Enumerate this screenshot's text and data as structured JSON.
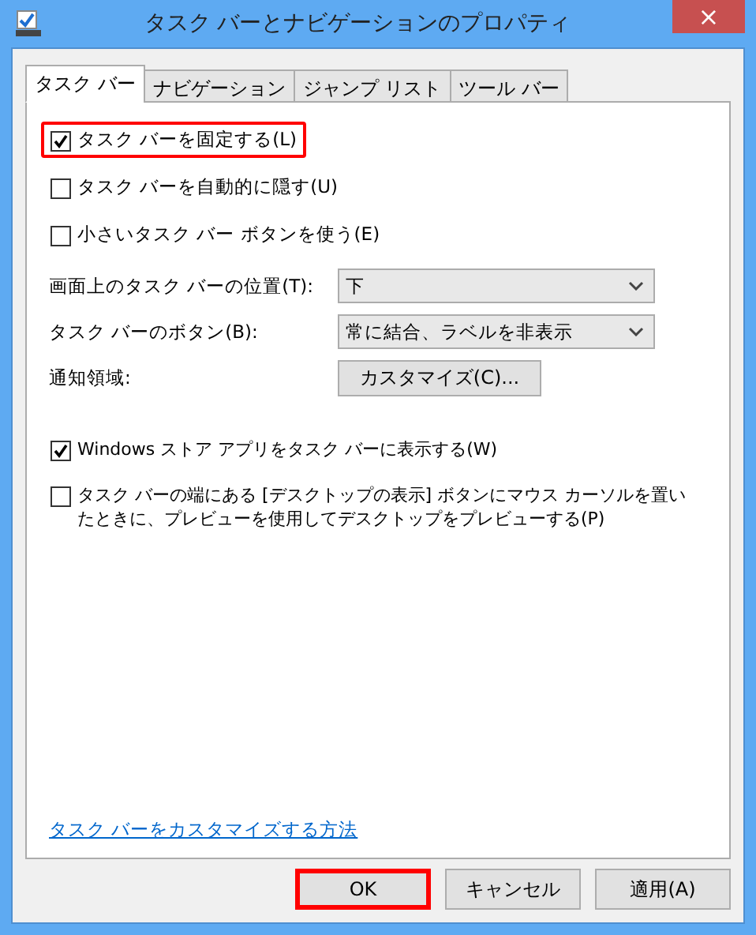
{
  "window": {
    "title": "タスク バーとナビゲーションのプロパティ",
    "close": "×"
  },
  "tabs": [
    {
      "label": "タスク バー",
      "selected": true
    },
    {
      "label": "ナビゲーション",
      "selected": false
    },
    {
      "label": "ジャンプ リスト",
      "selected": false
    },
    {
      "label": "ツール バー",
      "selected": false
    }
  ],
  "options_top": [
    {
      "label": "タスク バーを固定する(L)",
      "checked": true,
      "highlighted": true
    },
    {
      "label": "タスク バーを自動的に隠す(U)",
      "checked": false,
      "highlighted": false
    },
    {
      "label": "小さいタスク バー ボタンを使う(E)",
      "checked": false,
      "highlighted": false
    }
  ],
  "settings": [
    {
      "kind": "dropdown",
      "label": "画面上のタスク バーの位置(T):",
      "value": "下"
    },
    {
      "kind": "dropdown",
      "label": "タスク バーのボタン(B):",
      "value": "常に結合、ラベルを非表示"
    },
    {
      "kind": "button",
      "label": "通知領域:",
      "value": "カスタマイズ(C)..."
    }
  ],
  "options_bottom": [
    {
      "label": "Windows ストア アプリをタスク バーに表示する(W)",
      "checked": true,
      "highlighted": false
    },
    {
      "label": "タスク バーの端にある [デスクトップの表示] ボタンにマウス カーソルを置いたときに、プレビューを使用してデスクトップをプレビューする(P)",
      "checked": false,
      "highlighted": false
    }
  ],
  "help_link": "タスク バーをカスタマイズする方法",
  "buttons": [
    {
      "label": "OK",
      "highlighted": true
    },
    {
      "label": "キャンセル",
      "highlighted": false
    },
    {
      "label": "適用(A)",
      "highlighted": false
    }
  ]
}
